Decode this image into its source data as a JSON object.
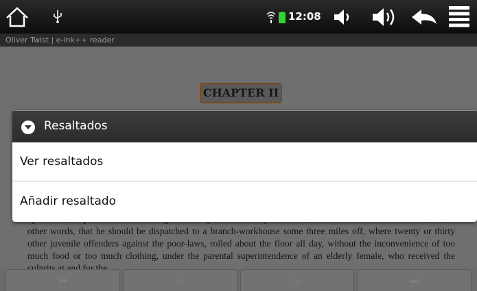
{
  "status_bar": {
    "time": "12:08",
    "icons": [
      "home-icon",
      "usb-icon",
      "wifi-icon",
      "battery-icon",
      "volume-down-icon",
      "volume-up-icon",
      "back-icon",
      "menu-icon"
    ]
  },
  "title_bar": {
    "title": "Oliver Twist | e-ink++ reader"
  },
  "reader": {
    "chapter_heading": "CHAPTER II",
    "text_lines": "upon this, the parish authorities magnanimously and humanely resolved, that Oliver should be \"farmed,\" or, in other words, that he should be dispatched to a branch-workhouse some three miles off, where twenty or thirty other juvenile offenders against the poor-laws, rolled about the floor all day, without the inconvenience of too much food or too much clothing, under the parental superintendence of an elderly female, who received the culprits at and for the"
  },
  "nav": {
    "first_label": "⏮",
    "prev_label": "◁",
    "next_label": "▷",
    "last_label": "⏭"
  },
  "dialog": {
    "title": "Resaltados",
    "items": [
      {
        "label": "Ver resaltados"
      },
      {
        "label": "Añadir resaltado"
      }
    ]
  },
  "colors": {
    "status_bar_bg": "#1a1a1a",
    "dialog_header_bg": "#333333",
    "chapter_border": "#7a4a1e",
    "battery": "#2fd62f"
  }
}
